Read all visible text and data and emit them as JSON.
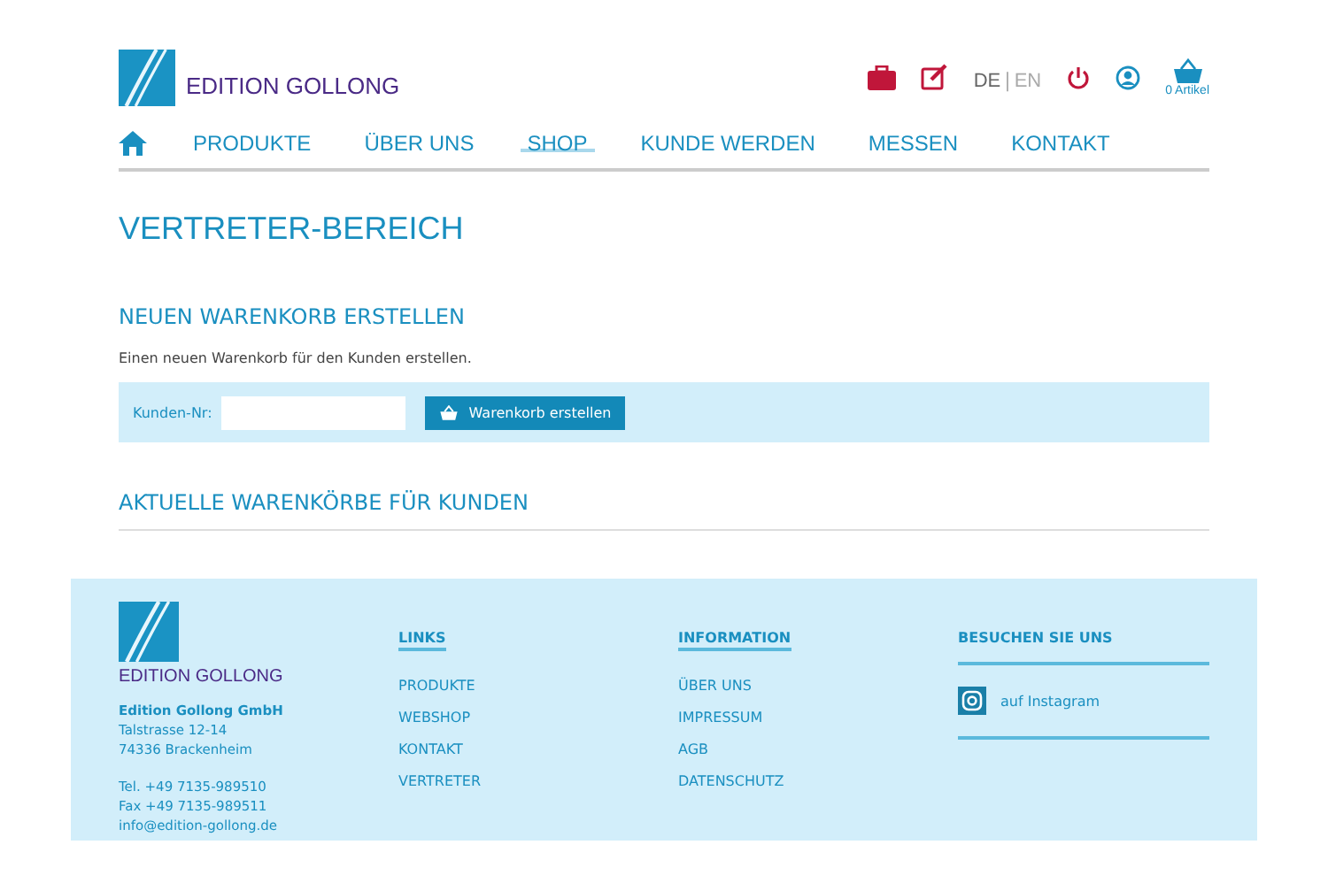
{
  "brand": {
    "name": "EDITION GOLLONG"
  },
  "header": {
    "language_separator": "|",
    "languages": [
      {
        "label": "DE",
        "selected": true
      },
      {
        "label": "EN",
        "selected": false
      }
    ],
    "cart": {
      "count": "0 Artikel"
    }
  },
  "nav": {
    "items": [
      {
        "label": "PRODUKTE",
        "selected": false
      },
      {
        "label": "ÜBER UNS",
        "selected": false
      },
      {
        "label": "SHOP",
        "selected": true
      },
      {
        "label": "KUNDE WERDEN",
        "selected": false
      },
      {
        "label": "MESSEN",
        "selected": false
      },
      {
        "label": "KONTAKT",
        "selected": false
      }
    ]
  },
  "page_title": "VERTRETER-BEREICH",
  "create_section": {
    "heading": "NEUEN WARENKORB ERSTELLEN",
    "description": "Einen neuen Warenkorb für den Kunden erstellen.",
    "field_label": "Kunden-Nr:",
    "button": "Warenkorb erstellen"
  },
  "current_section": {
    "heading": "AKTUELLE WARENKÖRBE FÜR KUNDEN"
  },
  "footer": {
    "brand": "EDITION GOLLONG",
    "company": "Edition Gollong GmbH",
    "address": [
      "Talstrasse 12-14",
      "74336 Brackenheim"
    ],
    "contact": [
      "Tel. +49 7135-989510",
      "Fax +49 7135-989511",
      "info@edition-gollong.de"
    ],
    "columns": [
      {
        "heading": "LINKS",
        "links": [
          "PRODUKTE",
          "WEBSHOP",
          "KONTAKT",
          "VERTRETER"
        ]
      },
      {
        "heading": "INFORMATION",
        "links": [
          "ÜBER UNS",
          "IMPRESSUM",
          "AGB",
          "DATENSCHUTZ"
        ]
      }
    ],
    "social": {
      "heading": "BESUCHEN SIE UNS",
      "link": "auf Instagram"
    }
  }
}
